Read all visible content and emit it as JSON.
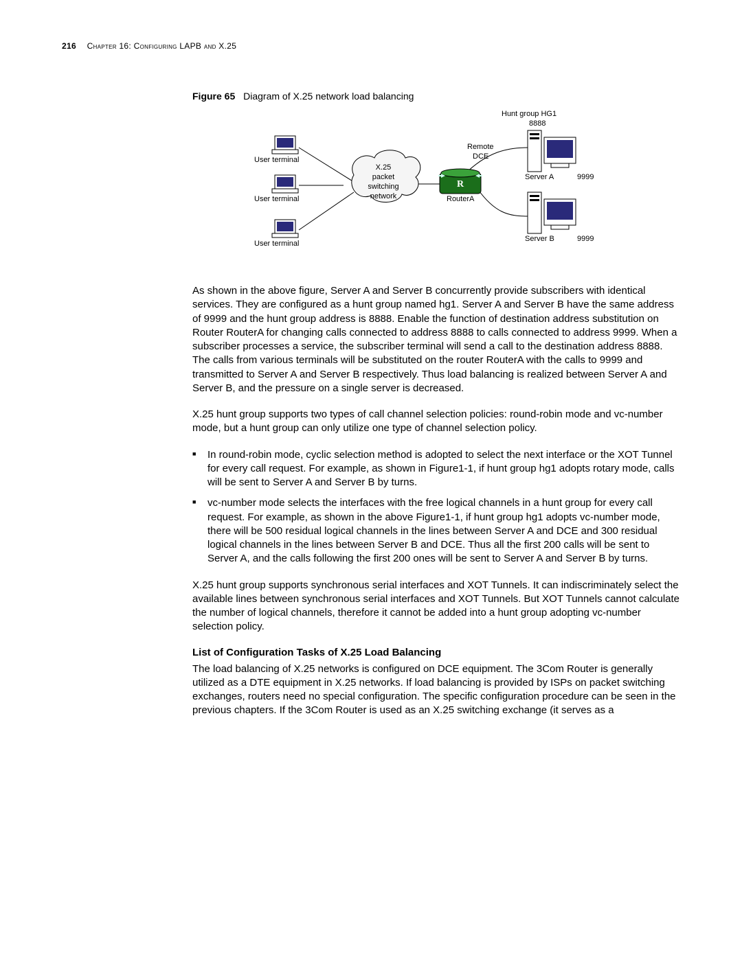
{
  "header": {
    "page_number": "216",
    "chapter": "Chapter 16: Configuring LAPB and X.25"
  },
  "figure": {
    "label": "Figure 65",
    "caption": "Diagram of X.25 network load balancing"
  },
  "diagram": {
    "hunt_group": "Hunt group HG1",
    "hunt_addr": "8888",
    "user_terminal": "User terminal",
    "cloud_line1": "X.25",
    "cloud_line2": "packet",
    "cloud_line3": "switching",
    "cloud_line4": "network",
    "remote_dce_line1": "Remote",
    "remote_dce_line2": "DCE",
    "router_a": "RouterA",
    "server_a": "Server A",
    "server_a_addr": "9999",
    "server_b": "Server B",
    "server_b_addr": "9999"
  },
  "paragraphs": {
    "p1": "As shown in the above figure, Server A and Server B concurrently provide subscribers with identical services. They are configured as a hunt group named hg1. Server A and Server B have the same address of 9999 and the hunt group address is 8888. Enable the function of destination address substitution on Router RouterA for changing calls connected to address 8888 to calls connected to address 9999. When a subscriber processes a service, the subscriber terminal will send a call to the destination address 8888. The calls from various terminals will be substituted on the router RouterA with the calls to 9999 and transmitted to Server A and Server B respectively. Thus load balancing is realized between Server A and Server B, and the pressure on a single server is decreased.",
    "p2": "X.25 hunt group supports two types of call channel selection policies: round-robin mode and vc-number mode, but a hunt group can only utilize one type of channel selection policy.",
    "b1": "In round-robin mode, cyclic selection method is adopted to select the next interface or the XOT Tunnel for every call request. For example, as shown in Figure1-1, if hunt group hg1 adopts rotary mode, calls will be sent to Server A and Server B by turns.",
    "b2": "vc-number mode selects the interfaces with the free logical channels in a hunt group for every call request. For example, as shown in the above Figure1-1, if hunt group hg1 adopts vc-number mode, there will be 500 residual logical channels in the lines between Server A and DCE and 300 residual logical channels in the lines between Server B and DCE. Thus all the first 200 calls will be sent to Server A, and the calls following the first 200 ones will be sent to Server A and Server B by turns.",
    "p3": "X.25 hunt group supports synchronous serial interfaces and XOT Tunnels. It can indiscriminately select the available lines between synchronous serial interfaces and XOT Tunnels. But XOT Tunnels cannot calculate the number of logical channels, therefore it cannot be added into a hunt group adopting vc-number selection policy.",
    "h4": "List of Configuration Tasks of X.25 Load Balancing",
    "p4": "The load balancing of X.25 networks is configured on DCE equipment. The 3Com Router is generally utilized as a DTE equipment in X.25 networks. If load balancing is provided by ISPs on packet switching exchanges, routers need no special configuration. The specific configuration procedure can be seen in the previous chapters. If the 3Com Router is used as an X.25 switching exchange (it serves as a"
  }
}
